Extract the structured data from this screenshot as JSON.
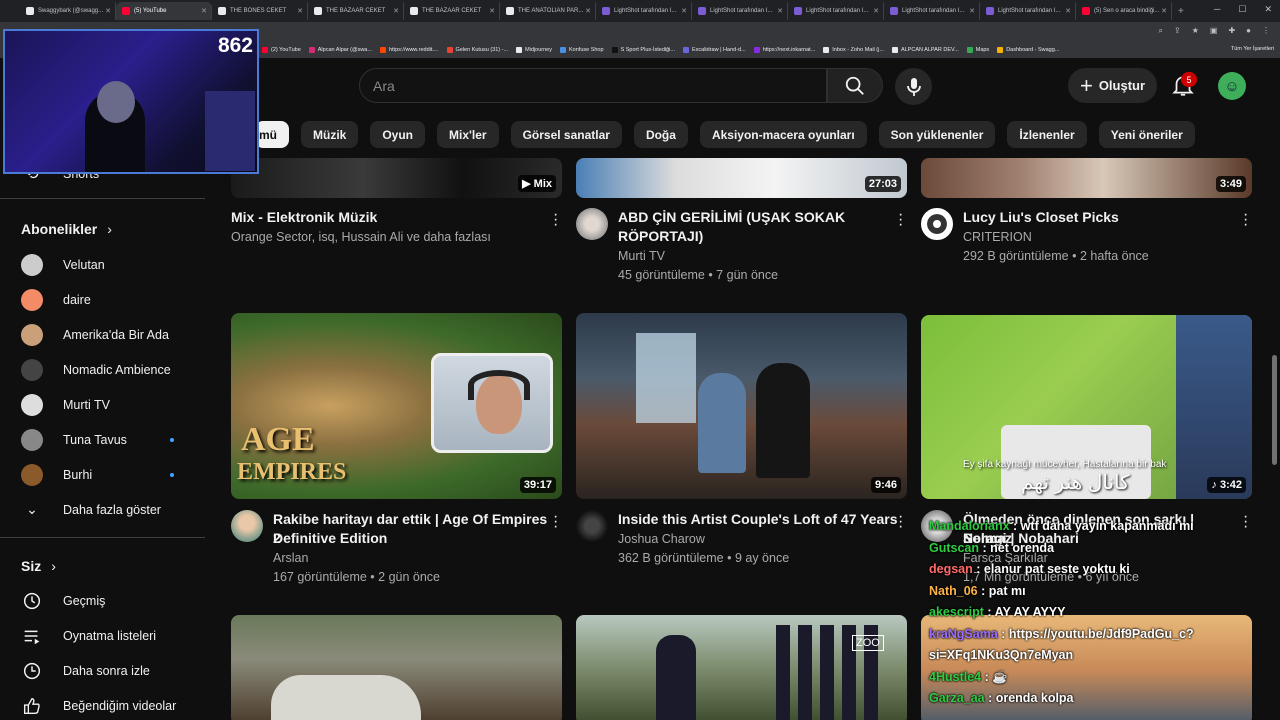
{
  "browser": {
    "tabs": [
      {
        "title": "Swaggybark (@swagg...",
        "color": "#e8eaed",
        "active": false
      },
      {
        "title": "(5) YouTube",
        "color": "#ff0033",
        "active": true
      },
      {
        "title": "THE BONES CEKET",
        "color": "#e8eaed",
        "active": false
      },
      {
        "title": "THE BAZAAR CEKET",
        "color": "#e8eaed",
        "active": false
      },
      {
        "title": "THE BAZAAR CEKET",
        "color": "#e8eaed",
        "active": false
      },
      {
        "title": "THE ANATOLIAN PAR...",
        "color": "#e8eaed",
        "active": false
      },
      {
        "title": "LightShot tarafından I...",
        "color": "#7b5cd6",
        "active": false
      },
      {
        "title": "LightShot tarafından I...",
        "color": "#7b5cd6",
        "active": false
      },
      {
        "title": "LightShot tarafından I...",
        "color": "#7b5cd6",
        "active": false
      },
      {
        "title": "LightShot tarafından I...",
        "color": "#7b5cd6",
        "active": false
      },
      {
        "title": "LightShot tarafından I...",
        "color": "#7b5cd6",
        "active": false
      },
      {
        "title": "(5) Sen o araca bindiği...",
        "color": "#ff0033",
        "active": false
      }
    ],
    "bookmarks": [
      {
        "label": "(2) YouTube",
        "color": "#ff0033"
      },
      {
        "label": "Alpcan Alpar (@swa...",
        "color": "#d62976"
      },
      {
        "label": "https://www.reddit....",
        "color": "#ff4500"
      },
      {
        "label": "Gelen Kutusu (31) -...",
        "color": "#ea4335"
      },
      {
        "label": "Midjourney",
        "color": "#e8eaed"
      },
      {
        "label": "Konfuse Shop",
        "color": "#4a90e2"
      },
      {
        "label": "S Sport Plus-İstediği...",
        "color": "#111111"
      },
      {
        "label": "Excalidraw | Hand-d...",
        "color": "#6965db"
      },
      {
        "label": "https://next.inkarnat...",
        "color": "#8a2be2"
      },
      {
        "label": "Inbox - Zoho Mail (j...",
        "color": "#e8eaed"
      },
      {
        "label": "ALPCAN ALPAR DEV...",
        "color": "#e8eaed"
      },
      {
        "label": "Maps",
        "color": "#34a853"
      },
      {
        "label": "Dashboard - Swagg...",
        "color": "#f4b400"
      }
    ],
    "bookmarks_right": "Tüm Yer İşaretleri"
  },
  "header": {
    "search_placeholder": "Ara",
    "create_label": "Oluştur",
    "notification_count": "5"
  },
  "chips": [
    "mü",
    "Müzik",
    "Oyun",
    "Mix'ler",
    "Görsel sanatlar",
    "Doğa",
    "Aksiyon-macera oyunları",
    "Son yüklenenler",
    "İzlenenler",
    "Yeni öneriler"
  ],
  "sidebar": {
    "shorts_label": "Shorts",
    "subscriptions_title": "Abonelikler",
    "subscriptions": [
      {
        "name": "Velutan",
        "color": "#cccccc",
        "new": false
      },
      {
        "name": "daire",
        "color": "#f28b66",
        "new": false
      },
      {
        "name": "Amerika'da Bir Ada",
        "color": "#c9a07a",
        "new": false
      },
      {
        "name": "Nomadic Ambience",
        "color": "#444444",
        "new": false
      },
      {
        "name": "Murti TV",
        "color": "#dddddd",
        "new": false
      },
      {
        "name": "Tuna Tavus",
        "color": "#888888",
        "new": true
      },
      {
        "name": "Burhi",
        "color": "#8b5a2b",
        "new": true
      }
    ],
    "show_more": "Daha fazla göster",
    "you_title": "Siz",
    "you_items": [
      "Geçmiş",
      "Oynatma listeleri",
      "Daha sonra izle",
      "Beğendiğim videolar"
    ]
  },
  "videos_row1": [
    {
      "title": "Mix - Elektronik Müzik",
      "line2": "",
      "channel": "Orange Sector, isq, Hussain Ali ve daha fazlası",
      "meta": "",
      "duration": "Mix"
    },
    {
      "title": "ABD ÇİN GERİLİMİ (UŞAK SOKAK",
      "line2": "RÖPORTAJI)",
      "channel": "Murti TV",
      "meta": "45 görüntüleme • 7 gün önce",
      "duration": "27:03"
    },
    {
      "title": "Lucy Liu's Closet Picks",
      "line2": "",
      "channel": "CRITERION",
      "meta": "292 B görüntüleme • 2 hafta önce",
      "duration": "3:49"
    }
  ],
  "videos_row2": [
    {
      "title": "Rakibe haritayı dar ettik | Age Of Empires 2",
      "line2": "Definitive Edition",
      "channel": "Arslan",
      "meta": "167 görüntüleme • 2 gün önce",
      "duration": "39:17"
    },
    {
      "title": "Inside this Artist Couple's Loft of 47 Years",
      "line2": "",
      "channel": "Joshua Charow",
      "meta": "362 B görüntüleme • 9 ay önce",
      "duration": "9:46"
    },
    {
      "title": "Ölmeden önce dinlenen son şarkı | Solmaz",
      "line2": "Neragi | Nobahari",
      "channel": "Farsça Şarkılar",
      "meta": "1,7 Mn görüntüleme • 6 yıl önce",
      "duration": "3:42"
    }
  ],
  "thumb_text": {
    "aoe_line1": "AGE",
    "aoe_line2": "EMPIRES",
    "persian_caption": "Ey şifa kaynağı mücevher, Hastalarına bir bak",
    "persian_logo": "كانال هنر تهم",
    "zoo_label": "ZOO"
  },
  "stream": {
    "viewer_count": "862",
    "chat": [
      {
        "user": "Mandalorianx",
        "msg": "wtf daha yayın kapanmadı mı",
        "color": "#2ecc40"
      },
      {
        "user": "Gutscan",
        "msg": "net orenda",
        "color": "#2ecc40"
      },
      {
        "user": "degsan",
        "msg": "elanur pat seste yoktu ki",
        "color": "#ff6a6a"
      },
      {
        "user": "Nath_06",
        "msg": "pat mı",
        "color": "#ffb347"
      },
      {
        "user": "akescript",
        "msg": "AY AY AYYY",
        "color": "#2ecc40"
      },
      {
        "user": "kraNgSama",
        "msg": "https://youtu.be/Jdf9PadGu_c?",
        "msg2": "si=XFq1NKu3Qn7eMyan",
        "color": "#9b6dff"
      },
      {
        "user": "4Hustle4",
        "msg": "☕",
        "color": "#2ecc40"
      },
      {
        "user": "Garza_aa",
        "msg": "orenda kolpa",
        "color": "#2ecc40"
      }
    ]
  }
}
